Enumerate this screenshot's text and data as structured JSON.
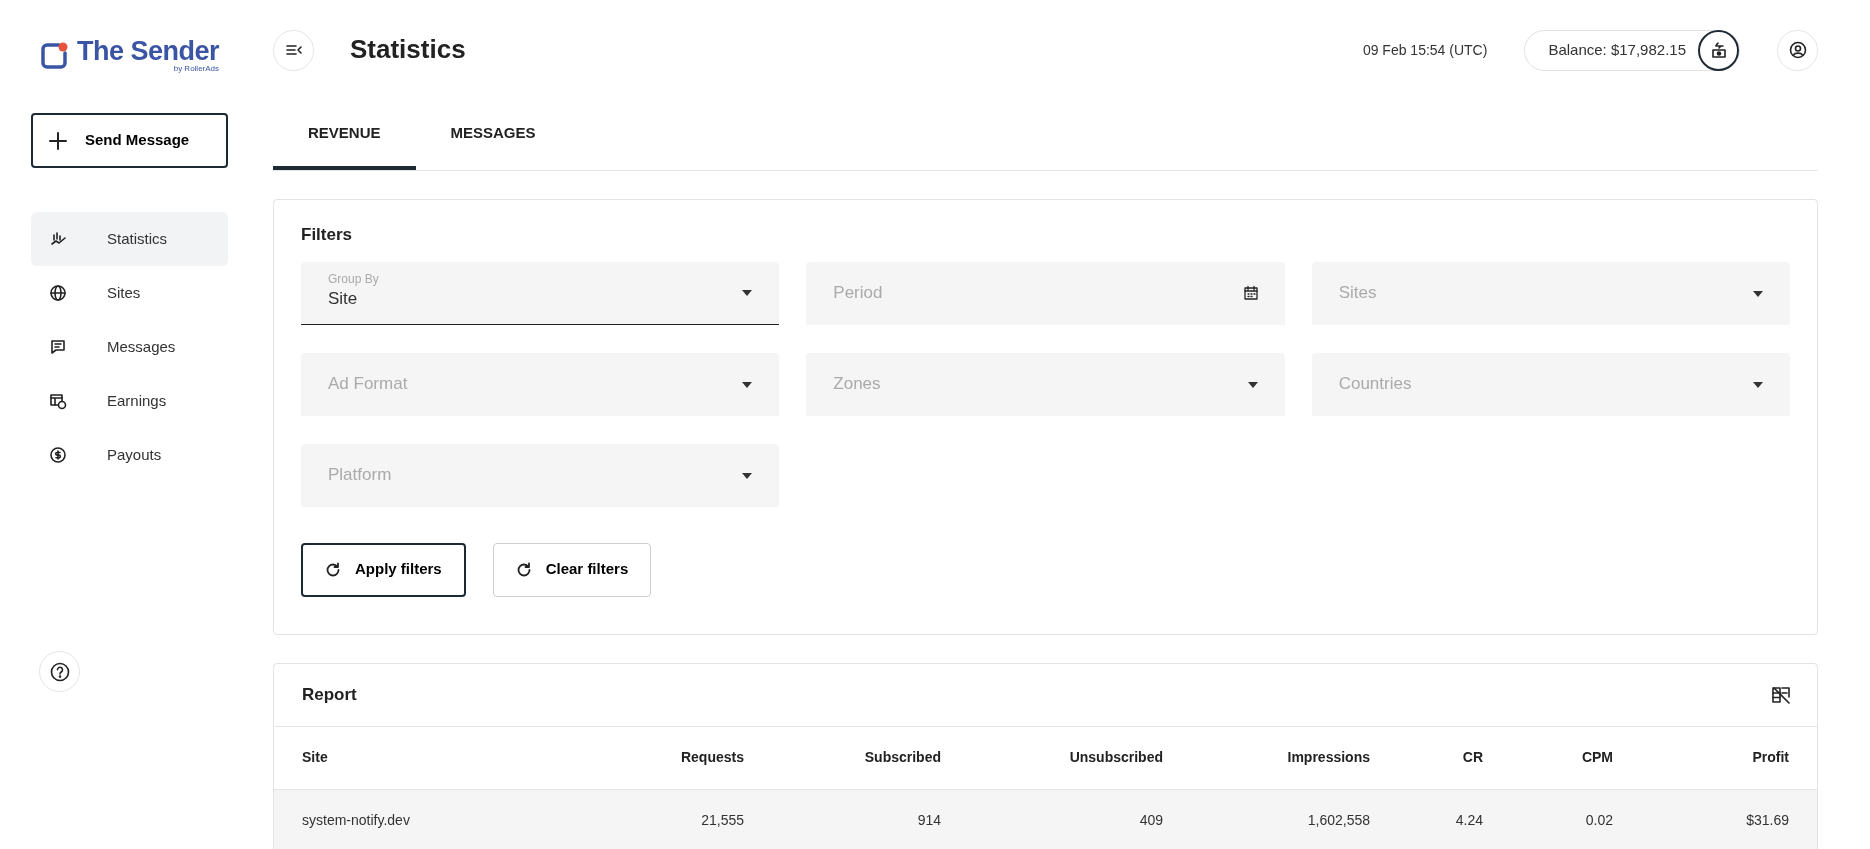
{
  "logo": {
    "name": "The Sender",
    "byline": "by RollerAds"
  },
  "send_button": {
    "label": "Send Message"
  },
  "nav": [
    {
      "label": "Statistics",
      "selected": true,
      "kind": "stats"
    },
    {
      "label": "Sites",
      "selected": false,
      "kind": "globe"
    },
    {
      "label": "Messages",
      "selected": false,
      "kind": "chat"
    },
    {
      "label": "Earnings",
      "selected": false,
      "kind": "earnings"
    },
    {
      "label": "Payouts",
      "selected": false,
      "kind": "coin"
    }
  ],
  "header": {
    "title": "Statistics",
    "datetime": "09 Feb 15:54 (UTC)",
    "balance": "Balance: $17,982.15"
  },
  "tabs": [
    {
      "label": "REVENUE",
      "selected": true
    },
    {
      "label": "MESSAGES",
      "selected": false
    }
  ],
  "filters": {
    "title": "Filters",
    "fields": [
      {
        "kind": "select",
        "label": "Group By",
        "value": "Site"
      },
      {
        "kind": "date",
        "placeholder": "Period"
      },
      {
        "kind": "select",
        "placeholder": "Sites"
      },
      {
        "kind": "select",
        "placeholder": "Ad Format"
      },
      {
        "kind": "select",
        "placeholder": "Zones"
      },
      {
        "kind": "select",
        "placeholder": "Countries"
      },
      {
        "kind": "select",
        "placeholder": "Platform"
      }
    ],
    "buttons": [
      {
        "label": "Apply filters",
        "primary": true
      },
      {
        "label": "Clear filters",
        "primary": false
      }
    ]
  },
  "report": {
    "title": "Report",
    "columns": [
      "Site",
      "Requests",
      "Subscribed",
      "Unsubscribed",
      "Impressions",
      "CR",
      "CPM",
      "Profit"
    ],
    "rows": [
      [
        "system-notify.dev",
        "21,555",
        "914",
        "409",
        "1,602,558",
        "4.24",
        "0.02",
        "$31.69"
      ]
    ]
  }
}
